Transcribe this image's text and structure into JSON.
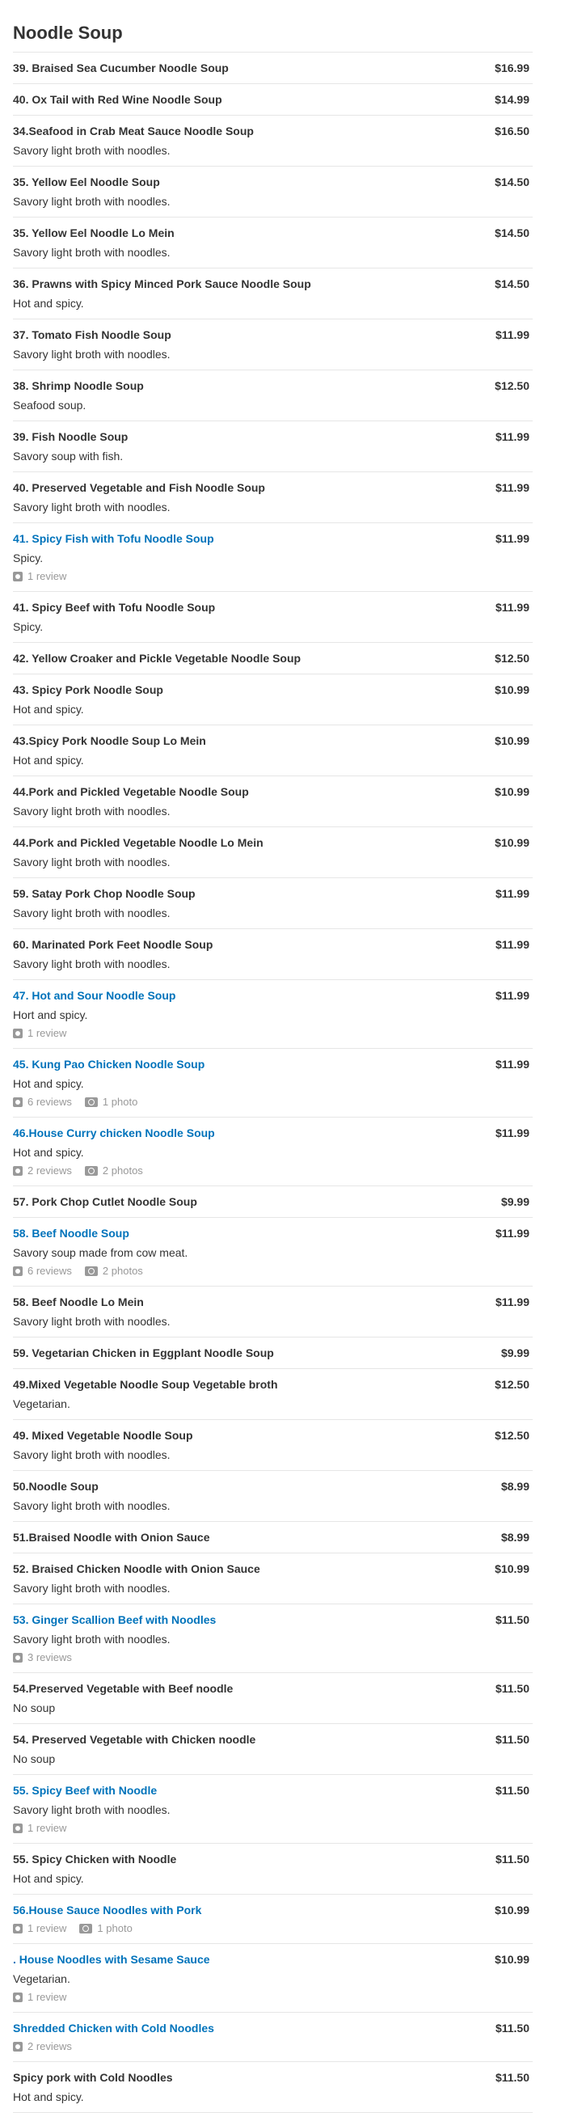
{
  "title": "Noodle Soup",
  "items": [
    {
      "name": "39. Braised Sea Cucumber Noodle Soup",
      "price": "$16.99",
      "desc": "",
      "link": false,
      "reviews": "",
      "photos": ""
    },
    {
      "name": "40. Ox Tail with Red Wine Noodle Soup",
      "price": "$14.99",
      "desc": "",
      "link": false,
      "reviews": "",
      "photos": ""
    },
    {
      "name": "34.Seafood in Crab Meat Sauce Noodle Soup",
      "price": "$16.50",
      "desc": "Savory light broth with noodles.",
      "link": false,
      "reviews": "",
      "photos": ""
    },
    {
      "name": "35. Yellow Eel Noodle Soup",
      "price": "$14.50",
      "desc": "Savory light broth with noodles.",
      "link": false,
      "reviews": "",
      "photos": ""
    },
    {
      "name": "35. Yellow Eel Noodle Lo Mein",
      "price": "$14.50",
      "desc": "Savory light broth with noodles.",
      "link": false,
      "reviews": "",
      "photos": ""
    },
    {
      "name": "36. Prawns with Spicy Minced Pork Sauce Noodle Soup",
      "price": "$14.50",
      "desc": "Hot and spicy.",
      "link": false,
      "reviews": "",
      "photos": ""
    },
    {
      "name": "37. Tomato Fish Noodle Soup",
      "price": "$11.99",
      "desc": "Savory light broth with noodles.",
      "link": false,
      "reviews": "",
      "photos": ""
    },
    {
      "name": "38. Shrimp Noodle Soup",
      "price": "$12.50",
      "desc": "Seafood soup.",
      "link": false,
      "reviews": "",
      "photos": ""
    },
    {
      "name": "39. Fish Noodle Soup",
      "price": "$11.99",
      "desc": "Savory soup with fish.",
      "link": false,
      "reviews": "",
      "photos": ""
    },
    {
      "name": "40. Preserved Vegetable and Fish Noodle Soup",
      "price": "$11.99",
      "desc": "Savory light broth with noodles.",
      "link": false,
      "reviews": "",
      "photos": ""
    },
    {
      "name": "41. Spicy Fish with Tofu Noodle Soup",
      "price": "$11.99",
      "desc": "Spicy.",
      "link": true,
      "reviews": "1 review",
      "photos": ""
    },
    {
      "name": "41. Spicy Beef with Tofu Noodle Soup",
      "price": "$11.99",
      "desc": "Spicy.",
      "link": false,
      "reviews": "",
      "photos": ""
    },
    {
      "name": "42. Yellow Croaker and Pickle Vegetable Noodle Soup",
      "price": "$12.50",
      "desc": "",
      "link": false,
      "reviews": "",
      "photos": ""
    },
    {
      "name": "43. Spicy Pork Noodle Soup",
      "price": "$10.99",
      "desc": "Hot and spicy.",
      "link": false,
      "reviews": "",
      "photos": ""
    },
    {
      "name": "43.Spicy Pork Noodle Soup Lo Mein",
      "price": "$10.99",
      "desc": "Hot and spicy.",
      "link": false,
      "reviews": "",
      "photos": ""
    },
    {
      "name": "44.Pork and Pickled Vegetable Noodle Soup",
      "price": "$10.99",
      "desc": "Savory light broth with noodles.",
      "link": false,
      "reviews": "",
      "photos": ""
    },
    {
      "name": "44.Pork and Pickled Vegetable Noodle Lo Mein",
      "price": "$10.99",
      "desc": "Savory light broth with noodles.",
      "link": false,
      "reviews": "",
      "photos": ""
    },
    {
      "name": "59. Satay Pork Chop Noodle Soup",
      "price": "$11.99",
      "desc": "Savory light broth with noodles.",
      "link": false,
      "reviews": "",
      "photos": ""
    },
    {
      "name": "60. Marinated Pork Feet Noodle Soup",
      "price": "$11.99",
      "desc": "Savory light broth with noodles.",
      "link": false,
      "reviews": "",
      "photos": ""
    },
    {
      "name": "47. Hot and Sour Noodle Soup",
      "price": "$11.99",
      "desc": "Hort and spicy.",
      "link": true,
      "reviews": "1 review",
      "photos": ""
    },
    {
      "name": "45. Kung Pao Chicken Noodle Soup",
      "price": "$11.99",
      "desc": "Hot and spicy.",
      "link": true,
      "reviews": "6 reviews",
      "photos": "1 photo"
    },
    {
      "name": "46.House Curry chicken Noodle Soup",
      "price": "$11.99",
      "desc": "Hot and spicy.",
      "link": true,
      "reviews": "2 reviews",
      "photos": "2 photos"
    },
    {
      "name": "57. Pork Chop Cutlet Noodle Soup",
      "price": "$9.99",
      "desc": "",
      "link": false,
      "reviews": "",
      "photos": ""
    },
    {
      "name": "58. Beef Noodle Soup",
      "price": "$11.99",
      "desc": "Savory soup made from cow meat.",
      "link": true,
      "reviews": "6 reviews",
      "photos": "2 photos"
    },
    {
      "name": "58. Beef Noodle Lo Mein",
      "price": "$11.99",
      "desc": "Savory light broth with noodles.",
      "link": false,
      "reviews": "",
      "photos": ""
    },
    {
      "name": "59. Vegetarian Chicken in Eggplant Noodle Soup",
      "price": "$9.99",
      "desc": "",
      "link": false,
      "reviews": "",
      "photos": ""
    },
    {
      "name": "49.Mixed Vegetable Noodle Soup Vegetable broth",
      "price": "$12.50",
      "desc": "Vegetarian.",
      "link": false,
      "reviews": "",
      "photos": ""
    },
    {
      "name": "49. Mixed Vegetable Noodle Soup",
      "price": "$12.50",
      "desc": "Savory light broth with noodles.",
      "link": false,
      "reviews": "",
      "photos": ""
    },
    {
      "name": "50.Noodle Soup",
      "price": "$8.99",
      "desc": "Savory light broth with noodles.",
      "link": false,
      "reviews": "",
      "photos": ""
    },
    {
      "name": "51.Braised Noodle with Onion Sauce",
      "price": "$8.99",
      "desc": "",
      "link": false,
      "reviews": "",
      "photos": ""
    },
    {
      "name": "52. Braised Chicken Noodle with Onion Sauce",
      "price": "$10.99",
      "desc": "Savory light broth with noodles.",
      "link": false,
      "reviews": "",
      "photos": ""
    },
    {
      "name": "53. Ginger Scallion Beef with Noodles",
      "price": "$11.50",
      "desc": "Savory light broth with noodles.",
      "link": true,
      "reviews": "3 reviews",
      "photos": ""
    },
    {
      "name": "54.Preserved Vegetable with Beef noodle",
      "price": "$11.50",
      "desc": "No soup",
      "link": false,
      "reviews": "",
      "photos": ""
    },
    {
      "name": "54. Preserved Vegetable with Chicken noodle",
      "price": "$11.50",
      "desc": "No soup",
      "link": false,
      "reviews": "",
      "photos": ""
    },
    {
      "name": "55. Spicy Beef with Noodle",
      "price": "$11.50",
      "desc": "Savory light broth with noodles.",
      "link": true,
      "reviews": "1 review",
      "photos": ""
    },
    {
      "name": "55. Spicy Chicken with Noodle",
      "price": "$11.50",
      "desc": "Hot and spicy.",
      "link": false,
      "reviews": "",
      "photos": ""
    },
    {
      "name": "56.House Sauce Noodles with Pork",
      "price": "$10.99",
      "desc": "",
      "link": true,
      "reviews": "1 review",
      "photos": "1 photo"
    },
    {
      "name": ". House Noodles with Sesame Sauce",
      "price": "$10.99",
      "desc": "Vegetarian.",
      "link": true,
      "reviews": "1 review",
      "photos": ""
    },
    {
      "name": "Shredded Chicken with Cold Noodles",
      "price": "$11.50",
      "desc": "",
      "link": true,
      "reviews": "2 reviews",
      "photos": ""
    },
    {
      "name": "Spicy pork with Cold Noodles",
      "price": "$11.50",
      "desc": "Hot and spicy.",
      "link": false,
      "reviews": "",
      "photos": ""
    }
  ],
  "colors": {
    "link": "#0073bb",
    "text": "#333333",
    "muted": "#999999",
    "divider": "#e6e6e6"
  },
  "icons": {
    "review": "review-icon",
    "photo": "camera-icon"
  }
}
